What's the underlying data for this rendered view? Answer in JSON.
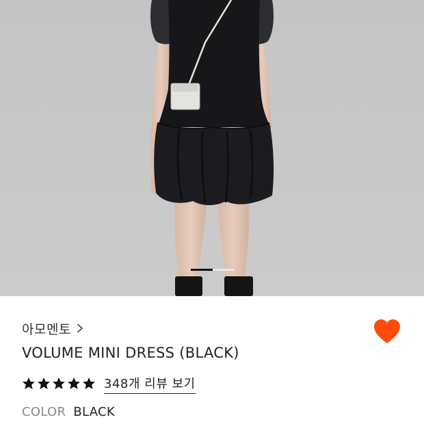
{
  "product": {
    "brand": "아모멘토",
    "title": "VOLUME MINI DRESS (BLACK)",
    "rating_stars": 5,
    "review_link": "348개 리뷰 보기",
    "color_label": "COLOR",
    "color_value": "BLACK",
    "favorited": true
  },
  "carousel": {
    "current_fraction": 0.5
  },
  "icons": {
    "brand_chevron": "chevron-right-icon",
    "favorite": "heart-icon",
    "star": "star-icon"
  },
  "colors": {
    "heart": "#ff4a0d",
    "star": "#111111",
    "photo_background": "#c6c6c6"
  }
}
